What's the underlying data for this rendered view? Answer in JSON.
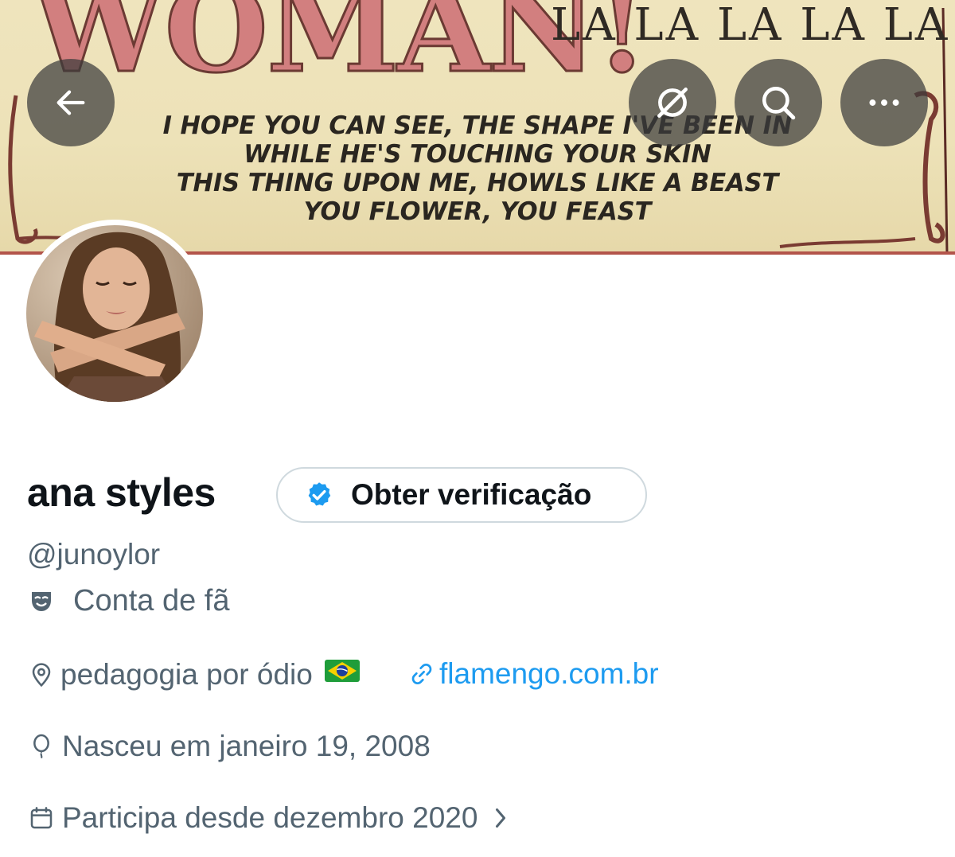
{
  "banner": {
    "headline": "WOMAN!",
    "la_text": "LA LA LA LA LA",
    "lyrics": [
      "I HOPE YOU CAN SEE, THE SHAPE I'VE BEEN IN",
      "WHILE HE'S TOUCHING YOUR SKIN",
      "THIS THING UPON ME, HOWLS LIKE A BEAST",
      "YOU FLOWER, YOU FEAST"
    ]
  },
  "nav": {
    "icons": [
      "arrow-left-icon",
      "grok-icon",
      "search-icon",
      "more-icon"
    ]
  },
  "profile": {
    "display_name": "ana styles",
    "verify_label": "Obter verificação",
    "handle": "@junoylor",
    "category": "Conta de fã",
    "location": "pedagogia por ódio",
    "flag": "🇧🇷",
    "website": "flamengo.com.br",
    "birthday": "Nasceu em janeiro 19, 2008",
    "joined": "Participa desde dezembro 2020"
  },
  "colors": {
    "accent": "#1d9bf0",
    "secondary_text": "#536471",
    "primary_text": "#0f1419",
    "headline_pink": "#d27f7f"
  }
}
